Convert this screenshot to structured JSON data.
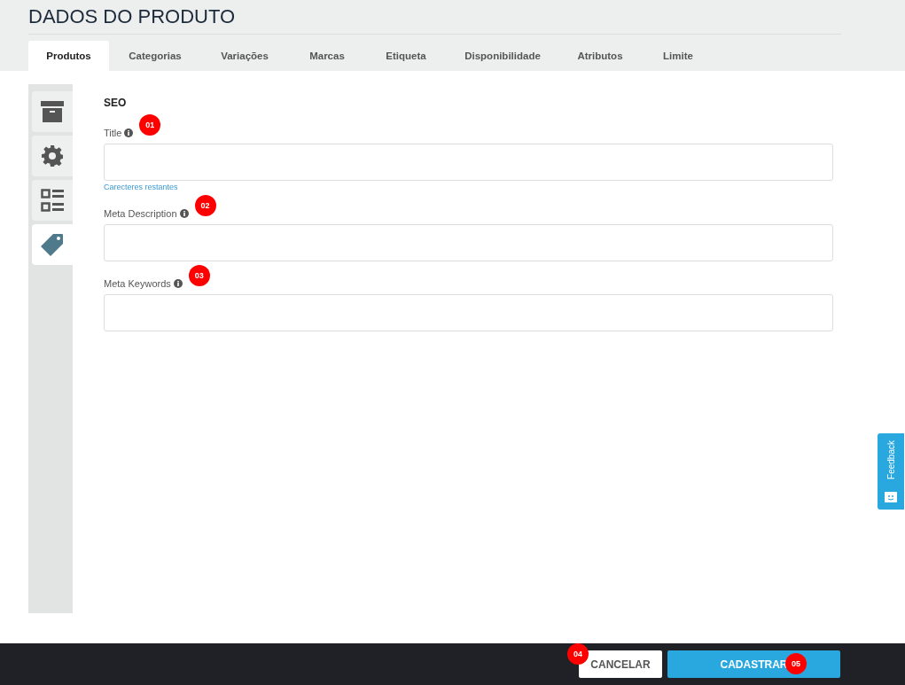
{
  "page_title": "DADOS DO PRODUTO",
  "tabs": [
    {
      "label": "Produtos",
      "selected": true
    },
    {
      "label": "Categorias",
      "selected": false
    },
    {
      "label": "Variações",
      "selected": false
    },
    {
      "label": "Marcas",
      "selected": false
    },
    {
      "label": "Etiqueta",
      "selected": false
    },
    {
      "label": "Disponibilidade",
      "selected": false
    },
    {
      "label": "Atributos",
      "selected": false
    },
    {
      "label": "Limite",
      "selected": false
    }
  ],
  "side_tabs": [
    {
      "kind": "box",
      "selected": false
    },
    {
      "kind": "gear",
      "selected": false
    },
    {
      "kind": "list",
      "selected": false
    },
    {
      "kind": "tag",
      "selected": true
    }
  ],
  "section_title": "SEO",
  "fields": [
    {
      "label": "Title",
      "marker": "01",
      "hint": "Carecteres restantes"
    },
    {
      "label": "Meta Description",
      "marker": "02"
    },
    {
      "label": "Meta Keywords",
      "marker": "03"
    }
  ],
  "buttons": [
    {
      "label": "CANCELAR",
      "kind": "secondary",
      "marker": "04"
    },
    {
      "label": "CADASTRAR",
      "kind": "primary",
      "marker": "05"
    }
  ],
  "feedback_tab": {
    "label": "Feedback"
  }
}
